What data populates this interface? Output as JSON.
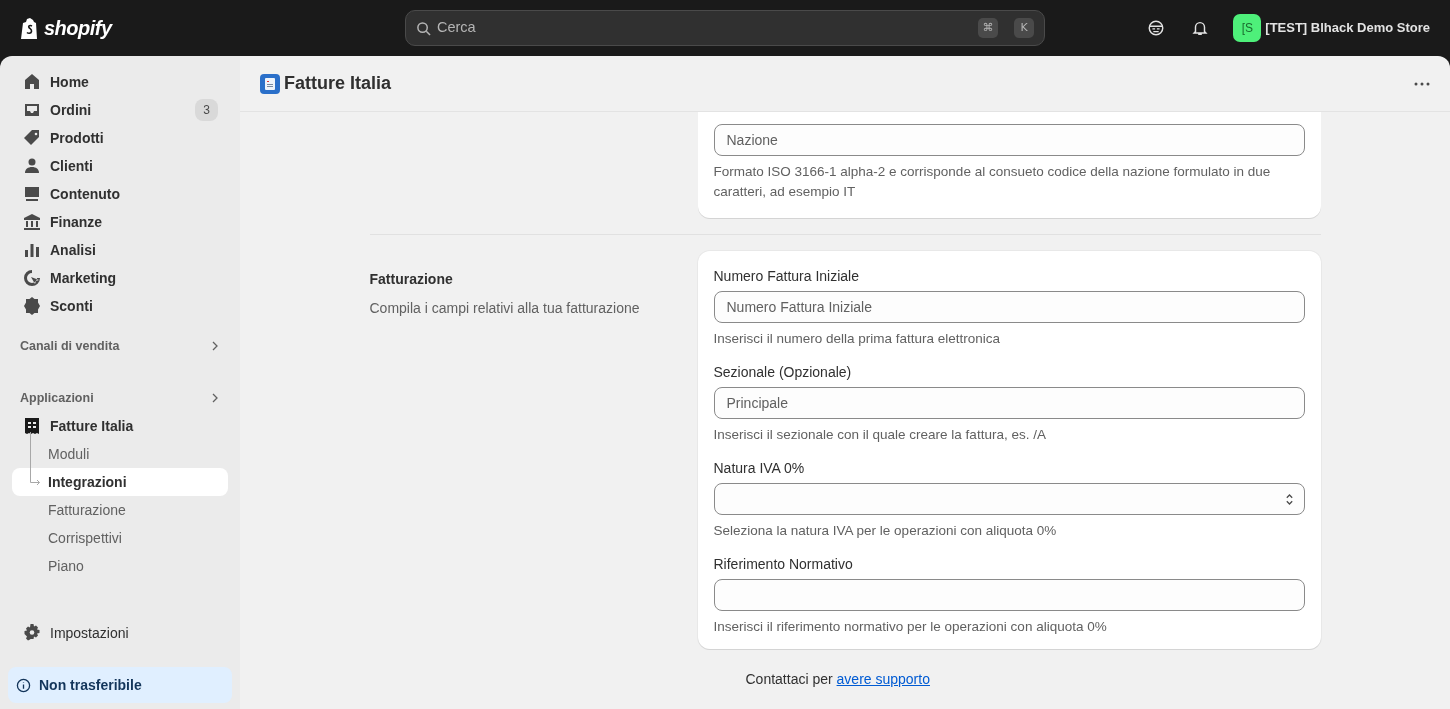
{
  "topbar": {
    "logo": "shopify",
    "search": {
      "placeholder": "Cerca",
      "keys": [
        "⌘",
        "K"
      ]
    },
    "store": {
      "avatar": "[S",
      "name": "[TEST] Blhack Demo Store"
    }
  },
  "sidebar": {
    "items": [
      {
        "label": "Home",
        "selected": false
      },
      {
        "label": "Ordini",
        "badge": "3",
        "selected": false
      },
      {
        "label": "Prodotti",
        "selected": false
      },
      {
        "label": "Clienti",
        "selected": false
      },
      {
        "label": "Contenuto",
        "selected": false
      },
      {
        "label": "Finanze",
        "selected": false
      },
      {
        "label": "Analisi",
        "selected": false
      },
      {
        "label": "Marketing",
        "selected": false
      },
      {
        "label": "Sconti",
        "selected": false
      }
    ],
    "sections": [
      {
        "title": "Canali di vendita"
      },
      {
        "title": "Applicazioni"
      }
    ],
    "app": {
      "label": "Fatture Italia",
      "children": [
        {
          "label": "Moduli",
          "selected": false
        },
        {
          "label": "Integrazioni",
          "selected": true
        },
        {
          "label": "Fatturazione",
          "selected": false
        },
        {
          "label": "Corrispettivi",
          "selected": false
        },
        {
          "label": "Piano",
          "selected": false
        }
      ]
    },
    "settings": "Impostazioni",
    "notice": "Non trasferibile"
  },
  "page": {
    "title": "Fatture Italia",
    "sections": [
      {
        "fields": [
          {
            "kind": "text",
            "placeholder": "Nazione",
            "help": "Formato ISO 3166-1 alpha-2 e corrisponde al consueto codice della nazione formulato in due caratteri, ad esempio IT"
          }
        ]
      },
      {
        "title": "Fatturazione",
        "description": "Compila i campi relativi alla tua fatturazione",
        "fields": [
          {
            "kind": "text",
            "label": "Numero Fattura Iniziale",
            "placeholder": "Numero Fattura Iniziale",
            "help": "Inserisci il numero della prima fattura elettronica"
          },
          {
            "kind": "text",
            "label": "Sezionale (Opzionale)",
            "placeholder": "Principale",
            "help": "Inserisci il sezionale con il quale creare la fattura, es. /A"
          },
          {
            "kind": "select",
            "label": "Natura IVA 0%",
            "help": "Seleziona la natura IVA per le operazioni con aliquota 0%"
          },
          {
            "kind": "text",
            "label": "Riferimento Normativo",
            "help": "Inserisci il riferimento normativo per le operazioni con aliquota 0%"
          }
        ]
      }
    ],
    "footer": {
      "text": "Contattaci per",
      "link": "avere supporto"
    }
  }
}
